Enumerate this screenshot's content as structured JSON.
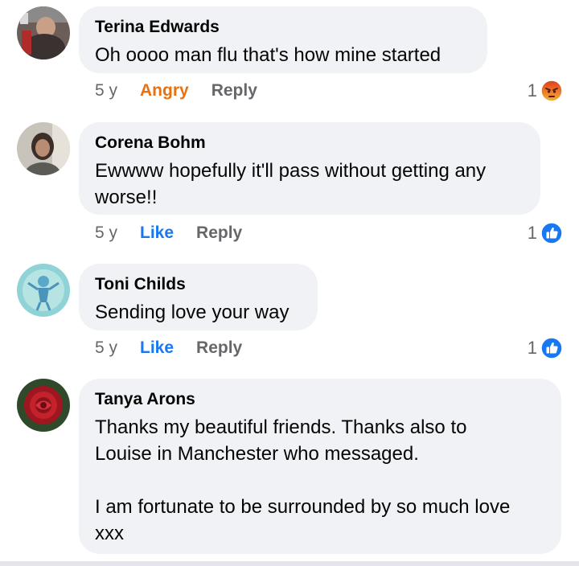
{
  "comments": [
    {
      "author": "Terina Edwards",
      "text": "Oh oooo man flu that's how mine started",
      "time": "5 y",
      "reaction_label": "Angry",
      "reply_label": "Reply",
      "reaction_count": "1",
      "reaction_icon": "angry-icon"
    },
    {
      "author": "Corena Bohm",
      "text": "Ewwww hopefully it'll pass without getting any\nworse!!",
      "time": "5 y",
      "reaction_label": "Like",
      "reply_label": "Reply",
      "reaction_count": "1",
      "reaction_icon": "like-icon"
    },
    {
      "author": "Toni Childs",
      "text": "Sending love your way",
      "time": "5 y",
      "reaction_label": "Like",
      "reply_label": "Reply",
      "reaction_count": "1",
      "reaction_icon": "like-icon"
    },
    {
      "author": "Tanya Arons",
      "text": "Thanks my beautiful friends. Thanks also to\nLouise in Manchester who messaged.\n\nI am fortunate to be surrounded by so much love\nxxx"
    }
  ],
  "colors": {
    "like": "#1877f2",
    "angry": "#e9710f",
    "bubble": "#f0f2f5",
    "meta": "#65676b"
  }
}
